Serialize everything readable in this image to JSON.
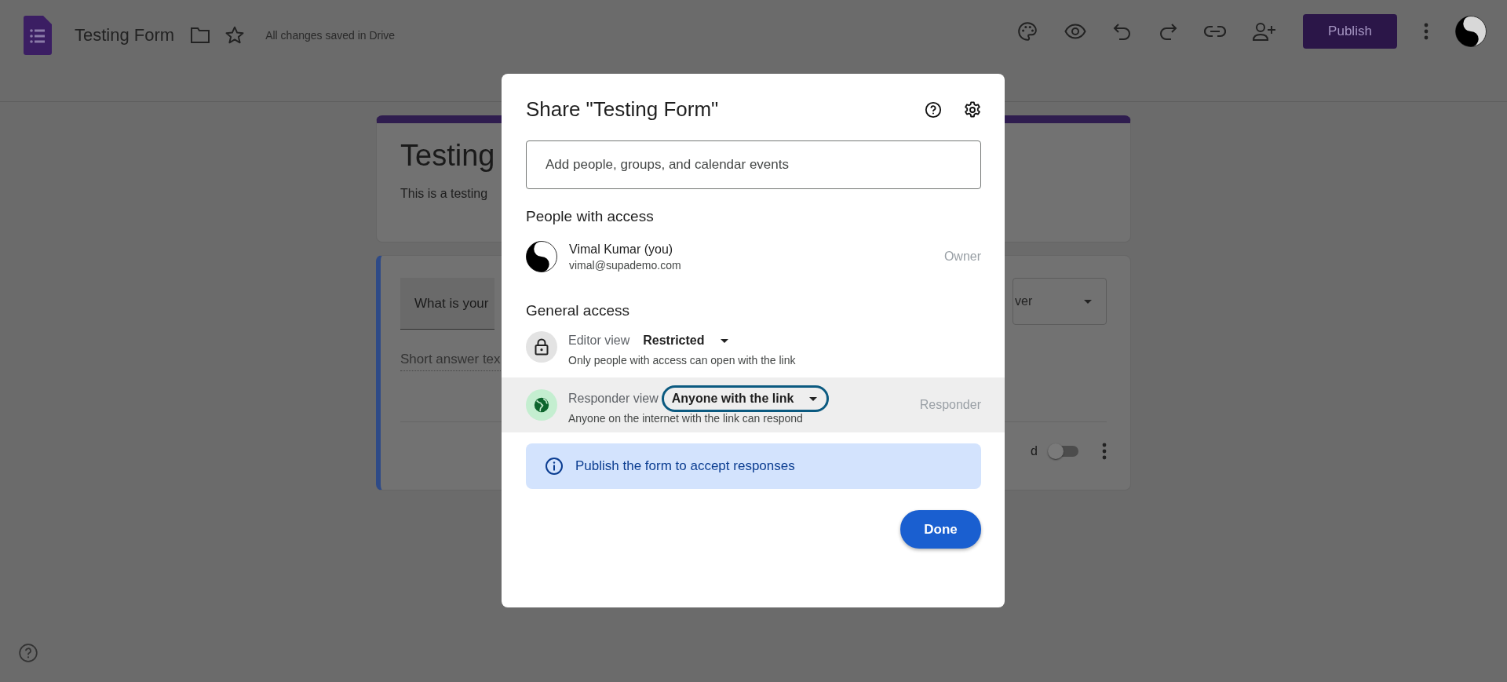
{
  "header": {
    "title": "Testing Form",
    "status": "All changes saved in Drive",
    "publish_button": "Publish"
  },
  "form": {
    "title": "Testing",
    "description": "This is a testing",
    "question": {
      "title": "What is your",
      "answer_hint": "Short answer tex",
      "type_dropdown": "ver",
      "required_label": "d",
      "required_on": false
    }
  },
  "dialog": {
    "title": "Share \"Testing Form\"",
    "add_people": {
      "placeholder": "Add people, groups, and calendar events"
    },
    "people_heading": "People with access",
    "people": [
      {
        "name": "Vimal Kumar (you)",
        "email": "vimal@supademo.com",
        "role": "Owner"
      }
    ],
    "general_heading": "General access",
    "access": [
      {
        "kind": "editor",
        "label": "Editor view",
        "value": "Restricted",
        "description": "Only people with access can open with the link",
        "selected": false
      },
      {
        "kind": "responder",
        "label": "Responder view",
        "value": "Anyone with the link",
        "description": "Anyone on the internet with the link can respond",
        "role": "Responder",
        "selected": true
      }
    ],
    "info": "Publish the form to accept responses",
    "done_button": "Done"
  }
}
